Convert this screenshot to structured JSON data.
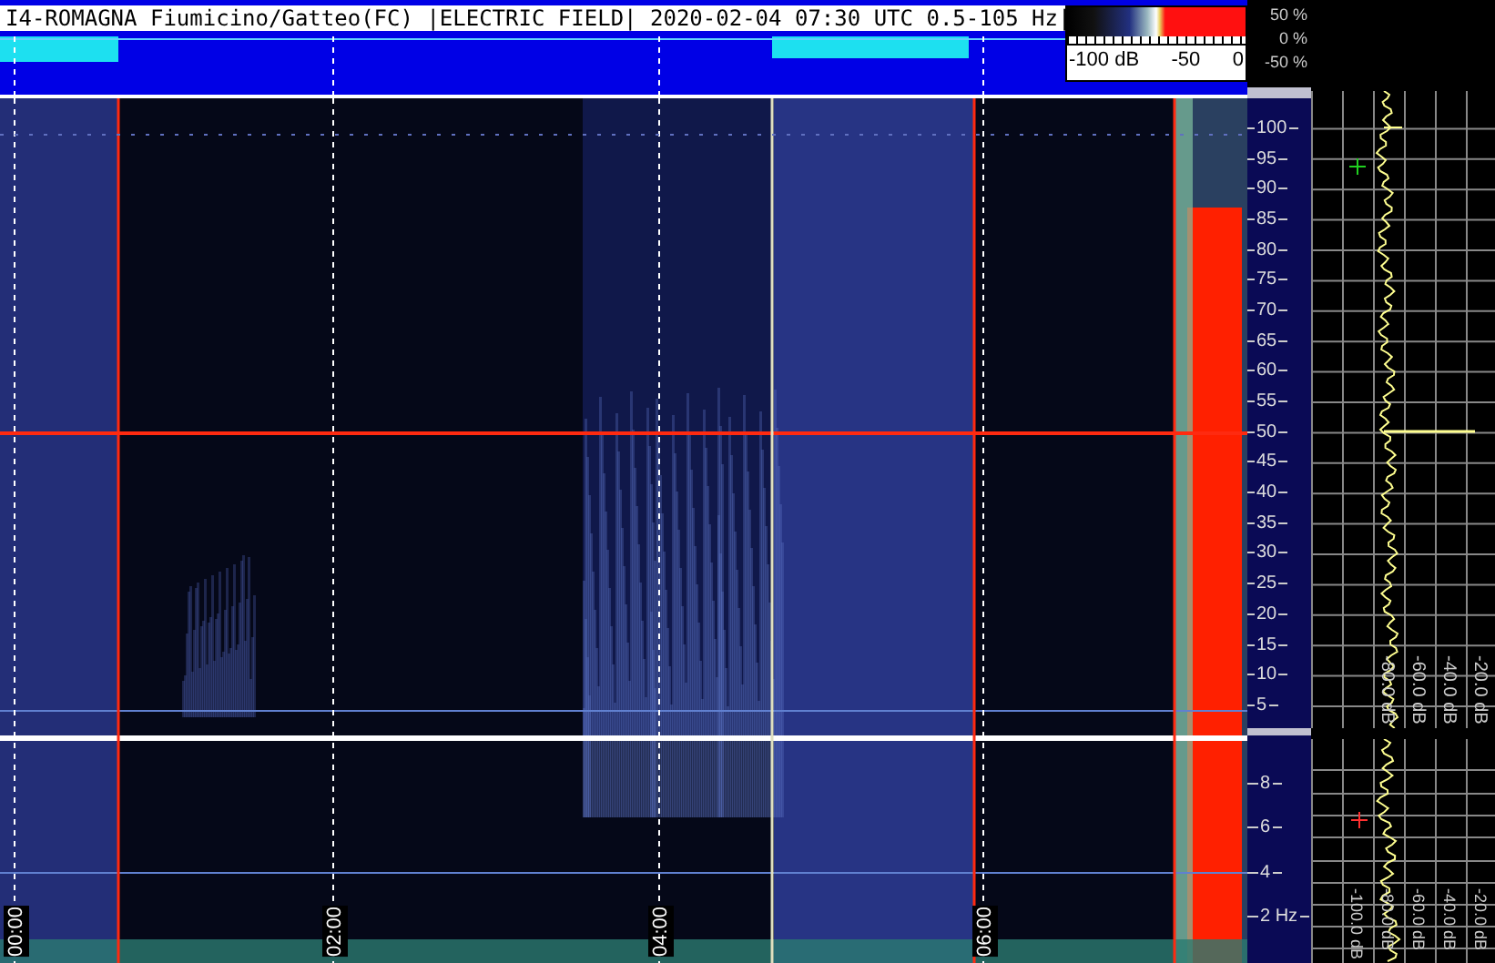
{
  "header": {
    "title": "I4-ROMAGNA Fiumicino/Gatteo(FC) |ELECTRIC FIELD| 2020-02-04 07:30 UTC 0.5-105 Hz|"
  },
  "color_scale": {
    "labels": [
      "-100 dB",
      "-50",
      "0"
    ]
  },
  "activity_scale": {
    "labels": [
      "50 %",
      "0 %",
      "-50 %"
    ]
  },
  "time_axis": {
    "labels": [
      "00:00",
      "02:00",
      "04:00",
      "06:00"
    ]
  },
  "frequency_axis_upper": {
    "labels": [
      "100",
      "95",
      "90",
      "85",
      "80",
      "75",
      "70",
      "65",
      "60",
      "55",
      "50",
      "45",
      "40",
      "35",
      "30",
      "25",
      "20",
      "15",
      "10",
      "5"
    ]
  },
  "frequency_axis_lower": {
    "labels": [
      "8",
      "6",
      "4",
      "2 Hz"
    ]
  },
  "spectrum_upper": {
    "db_labels": [
      "-80.0 dB",
      "-60.0 dB",
      "-40.0 dB",
      "-20.0 dB"
    ]
  },
  "spectrum_lower": {
    "db_labels": [
      "-100.0 dB",
      "-80.0 dB",
      "-60.0 dB",
      "-40.0 dB",
      "-20.0 dB"
    ]
  }
}
